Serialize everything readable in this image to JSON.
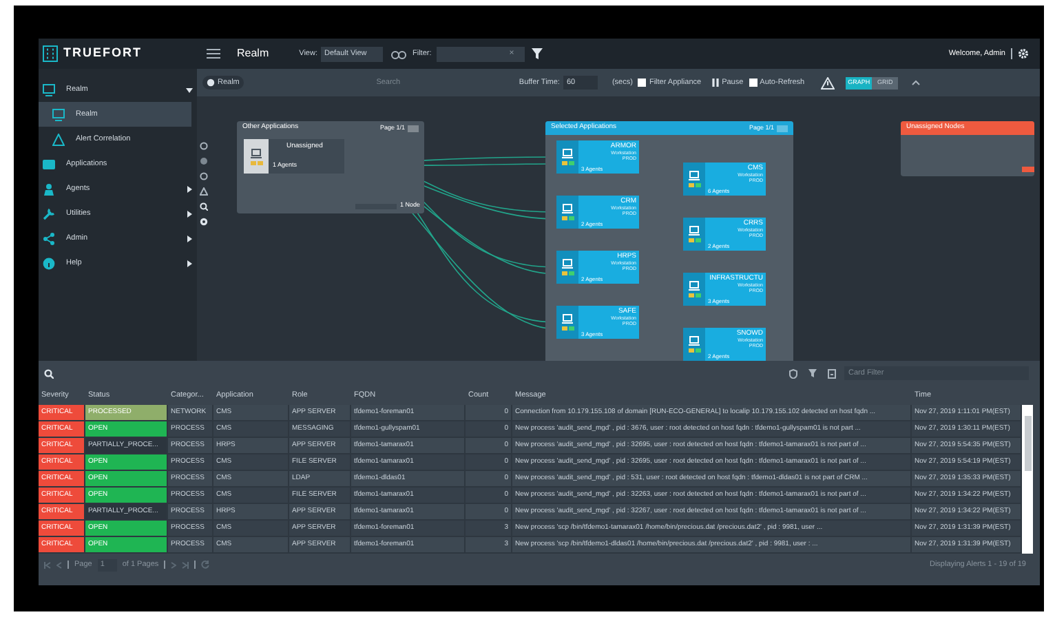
{
  "header": {
    "logo": "TRUEFORT",
    "title": "Realm",
    "view_label": "View:",
    "view_value": "Default View",
    "filter_label": "Filter:",
    "filter_clear": "×",
    "welcome": "Welcome, Admin"
  },
  "sidebar": {
    "items": [
      {
        "label": "Realm",
        "kind": "group",
        "selected": false,
        "expanded": true,
        "children": [
          {
            "label": "Realm",
            "selected": true
          },
          {
            "label": "Alert Correlation",
            "selected": false
          }
        ]
      },
      {
        "label": "Applications",
        "kind": "link",
        "selected": false
      },
      {
        "label": "Agents",
        "kind": "group",
        "selected": false,
        "expanded": false
      },
      {
        "label": "Utilities",
        "kind": "group",
        "selected": false,
        "expanded": false
      },
      {
        "label": "Admin",
        "kind": "group",
        "selected": false,
        "expanded": false
      },
      {
        "label": "Help",
        "kind": "group",
        "selected": false,
        "expanded": false
      }
    ]
  },
  "toolbar": {
    "realm_chip": "Realm",
    "search_placeholder": "Search",
    "buffer_label": "Buffer Time:",
    "buffer_value": "60",
    "buffer_unit": "(secs)",
    "filter_appliance": {
      "label": "Filter Appliance",
      "checked": false
    },
    "pause": "Pause",
    "auto_refresh": {
      "label": "Auto-Refresh",
      "checked": false
    },
    "modes": [
      {
        "label": "GRAPH",
        "selected": true
      },
      {
        "label": "GRID",
        "selected": false
      }
    ]
  },
  "canvas": {
    "other_applications": {
      "title": "Other Applications",
      "page": "Page 1/1",
      "nodes": [
        {
          "name": "Unassigned",
          "agents": "1 Agents"
        }
      ],
      "footer": "1 Node"
    },
    "selected_applications": {
      "title": "Selected Applications",
      "page": "Page 1/1",
      "nodes": [
        {
          "name": "ARMOR",
          "type": "Workstation",
          "env": "PROD",
          "agents": "3 Agents"
        },
        {
          "name": "CRM",
          "type": "Workstation",
          "env": "PROD",
          "agents": "2 Agents"
        },
        {
          "name": "HRPS",
          "type": "Workstation",
          "env": "PROD",
          "agents": "2 Agents"
        },
        {
          "name": "SAFE",
          "type": "Workstation",
          "env": "PROD",
          "agents": "3 Agents"
        },
        {
          "name": "CMS",
          "type": "Workstation",
          "env": "PROD",
          "agents": "6 Agents"
        },
        {
          "name": "CRRS",
          "type": "Workstation",
          "env": "PROD",
          "agents": "2 Agents"
        },
        {
          "name": "INFRASTRUCTU",
          "type": "Workstation",
          "env": "PROD",
          "agents": "3 Agents"
        },
        {
          "name": "SNOWD",
          "type": "Workstation",
          "env": "PROD",
          "agents": "2 Agents"
        }
      ]
    },
    "unassigned_nodes": {
      "title": "Unassigned Nodes"
    }
  },
  "alerts": {
    "filter_placeholder": "Card Filter",
    "columns": [
      "Severity",
      "Status",
      "Categor...",
      "Application",
      "Role",
      "FQDN",
      "Count",
      "Message",
      "Time"
    ],
    "rows": [
      {
        "cells": [
          {
            "text": "CRITICAL",
            "color": "#ee4b3b"
          },
          {
            "text": "PROCESSED",
            "color": "#8fae6a"
          },
          "NETWORK",
          "CMS",
          "APP SERVER",
          "tfdemo1-foreman01",
          "0",
          "Connection from 10.179.155.108 of domain [RUN-ECO-GENERAL] to localip 10.179.155.102 detected on host fqdn ...",
          "Nov 27, 2019 1:11:01 PM(EST)"
        ]
      },
      {
        "cells": [
          {
            "text": "CRITICAL",
            "color": "#ee4b3b"
          },
          {
            "text": "OPEN",
            "color": "#1fb553"
          },
          "PROCESS",
          "CMS",
          "MESSAGING",
          "tfdemo1-gullyspam01",
          "0",
          "New process 'audit_send_mgd' , pid : 3676, user : root detected on host fqdn : tfdemo1-gullyspam01 is not part ...",
          "Nov 27, 2019 1:30:11 PM(EST)"
        ]
      },
      {
        "cells": [
          {
            "text": "CRITICAL",
            "color": "#ee4b3b"
          },
          {
            "text": "PARTIALLY_PROCE..."
          },
          "PROCESS",
          "HRPS",
          "APP SERVER",
          "tfdemo1-tamarax01",
          "0",
          "New process 'audit_send_mgd' , pid : 32695, user : root detected on host fqdn : tfdemo1-tamarax01 is not part of ...",
          "Nov 27, 2019 5:54:35 PM(EST)"
        ]
      },
      {
        "cells": [
          {
            "text": "CRITICAL",
            "color": "#ee4b3b"
          },
          {
            "text": "OPEN",
            "color": "#1fb553"
          },
          "PROCESS",
          "CMS",
          "FILE SERVER",
          "tfdemo1-tamarax01",
          "0",
          "New process 'audit_send_mgd' , pid : 32695, user : root detected on host fqdn : tfdemo1-tamarax01 is not part of ...",
          "Nov 27, 2019 5:54:19 PM(EST)"
        ]
      },
      {
        "cells": [
          {
            "text": "CRITICAL",
            "color": "#ee4b3b"
          },
          {
            "text": "OPEN",
            "color": "#1fb553"
          },
          "PROCESS",
          "CMS",
          "LDAP",
          "tfdemo1-dldas01",
          "0",
          "New process 'audit_send_mgd' , pid : 531, user : root detected on host fqdn : tfdemo1-dldas01 is not part of CRM ...",
          "Nov 27, 2019 1:35:33 PM(EST)"
        ]
      },
      {
        "cells": [
          {
            "text": "CRITICAL",
            "color": "#ee4b3b"
          },
          {
            "text": "OPEN",
            "color": "#1fb553"
          },
          "PROCESS",
          "CMS",
          "FILE SERVER",
          "tfdemo1-tamarax01",
          "0",
          "New process 'audit_send_mgd' , pid : 32263, user : root detected on host fqdn : tfdemo1-tamarax01 is not part of ...",
          "Nov 27, 2019 1:34:22 PM(EST)"
        ]
      },
      {
        "cells": [
          {
            "text": "CRITICAL",
            "color": "#ee4b3b"
          },
          {
            "text": "PARTIALLY_PROCE..."
          },
          "PROCESS",
          "HRPS",
          "APP SERVER",
          "tfdemo1-tamarax01",
          "0",
          "New process 'audit_send_mgd' , pid : 32267, user : root detected on host fqdn : tfdemo1-tamarax01 is not part of ...",
          "Nov 27, 2019 1:34:22 PM(EST)"
        ]
      },
      {
        "cells": [
          {
            "text": "CRITICAL",
            "color": "#ee4b3b"
          },
          {
            "text": "OPEN",
            "color": "#1fb553"
          },
          "PROCESS",
          "CMS",
          "APP SERVER",
          "tfdemo1-foreman01",
          "3",
          "New process 'scp /bin/tfdemo1-tamarax01 /home/bin/precious.dat /precious.dat2' , pid : 9981, user ...",
          "Nov 27, 2019 1:31:39 PM(EST)"
        ]
      },
      {
        "cells": [
          {
            "text": "CRITICAL",
            "color": "#ee4b3b"
          },
          {
            "text": "OPEN",
            "color": "#1fb553"
          },
          "PROCESS",
          "CMS",
          "APP SERVER",
          "tfdemo1-foreman01",
          "3",
          "New process 'scp /bin/tfdemo1-dldas01 /home/bin/precious.dat /precious.dat2' , pid : 9981, user : ...",
          "Nov 27, 2019 1:31:39 PM(EST)"
        ]
      }
    ],
    "pager": {
      "page_label": "Page",
      "page_value": "1",
      "of_pages": "of 1 Pages"
    },
    "summary": "Displaying Alerts 1 - 19 of 19"
  }
}
